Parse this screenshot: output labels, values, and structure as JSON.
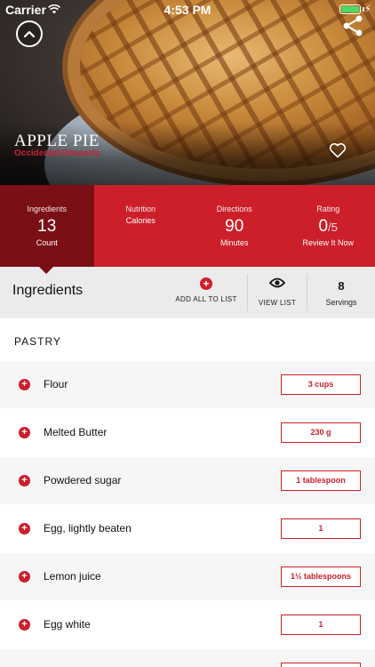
{
  "status_bar": {
    "carrier": "Carrier",
    "time": "4:53 PM"
  },
  "recipe": {
    "title": "APPLE PIE",
    "subtitle": "Occidental Desserts"
  },
  "stats": [
    {
      "label": "Ingredients",
      "value": "13",
      "sub": "Count"
    },
    {
      "label": "Nutrition",
      "value": "",
      "sub": "Calories"
    },
    {
      "label": "Directions",
      "value": "90",
      "sub": "Minutes"
    },
    {
      "label": "Rating",
      "value": "0",
      "value_suffix": "/5",
      "sub": "Review It Now"
    }
  ],
  "toolbar": {
    "title": "Ingredients",
    "add_all_label": "ADD ALL TO LIST",
    "view_list_label": "VIEW LIST",
    "servings_count": "8",
    "servings_label": "Servings"
  },
  "section": {
    "title": "PASTRY"
  },
  "ingredients": [
    {
      "name": "Flour",
      "quantity": "3 cups"
    },
    {
      "name": "Melted Butter",
      "quantity": "230 g"
    },
    {
      "name": "Powdered sugar",
      "quantity": "1 tablespoon"
    },
    {
      "name": "Egg, lightly beaten",
      "quantity": "1"
    },
    {
      "name": "Lemon juice",
      "quantity": "1½ tablespoons"
    },
    {
      "name": "Egg white",
      "quantity": "1"
    }
  ],
  "colors": {
    "accent": "#cc1f2a",
    "accent_dark": "#7b0f16",
    "toolbar_bg": "#ebebeb"
  },
  "icons": {
    "back": "chevron-up-icon",
    "share": "share-icon",
    "favorite": "heart-icon",
    "add": "plus-circle-icon",
    "view": "eye-icon"
  }
}
